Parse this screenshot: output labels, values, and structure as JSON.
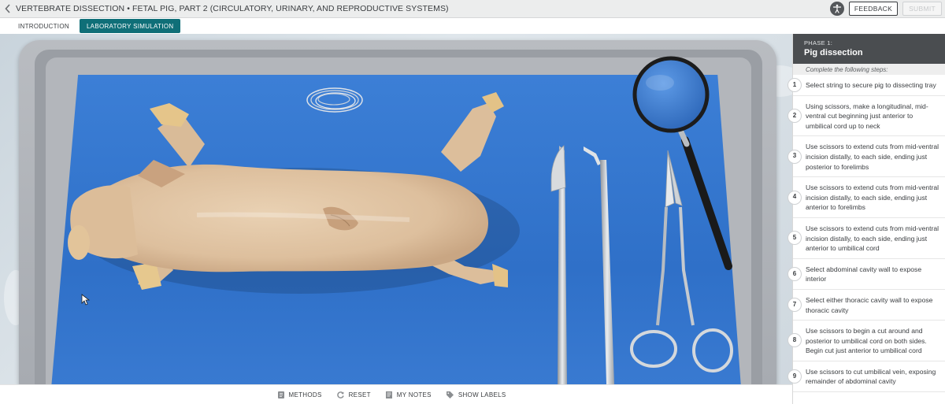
{
  "header": {
    "title": "VERTEBRATE DISSECTION • FETAL PIG, PART 2 (CIRCULATORY, URINARY, AND REPRODUCTIVE SYSTEMS)",
    "feedback_label": "FEEDBACK",
    "submit_label": "SUBMIT"
  },
  "tabs": [
    {
      "label": "INTRODUCTION"
    },
    {
      "label": "LABORATORY SIMULATION"
    }
  ],
  "panel": {
    "phase_label": "PHASE 1:",
    "phase_title": "Pig dissection",
    "instruction": "Complete the following steps:",
    "steps": [
      {
        "num": "1",
        "text": "Select string to secure pig to dissecting tray"
      },
      {
        "num": "2",
        "text": "Using scissors, make a longitudinal, mid-ventral cut beginning just anterior to umbilical cord up to neck"
      },
      {
        "num": "3",
        "text": "Use scissors to extend cuts from mid-ventral incision distally, to each side, ending just posterior to forelimbs"
      },
      {
        "num": "4",
        "text": "Use scissors to extend cuts from mid-ventral incision distally, to each side, ending just anterior to forelimbs"
      },
      {
        "num": "5",
        "text": "Use scissors to extend cuts from mid-ventral incision distally, to each side, ending just anterior to umbilical cord"
      },
      {
        "num": "6",
        "text": "Select abdominal cavity wall to expose interior"
      },
      {
        "num": "7",
        "text": "Select either thoracic cavity wall to expose thoracic cavity"
      },
      {
        "num": "8",
        "text": "Use scissors to begin a cut around and posterior to umbilical cord on both sides. Begin cut just anterior to umbilical cord"
      },
      {
        "num": "9",
        "text": "Use scissors to cut umbilical vein, exposing remainder of abdominal cavity"
      }
    ]
  },
  "toolbar": {
    "methods_label": "METHODS",
    "reset_label": "RESET",
    "notes_label": "MY NOTES",
    "labels_label": "SHOW LABELS"
  },
  "icons": {
    "back": "chevron-left-icon",
    "accessibility": "accessibility-icon",
    "methods": "book-icon",
    "reset": "reset-icon",
    "notes": "notes-icon",
    "labels": "tag-icon"
  },
  "colors": {
    "active_tab": "#0f6f78",
    "phase_header": "#4a4d50",
    "mat_blue": "#3377cf"
  }
}
